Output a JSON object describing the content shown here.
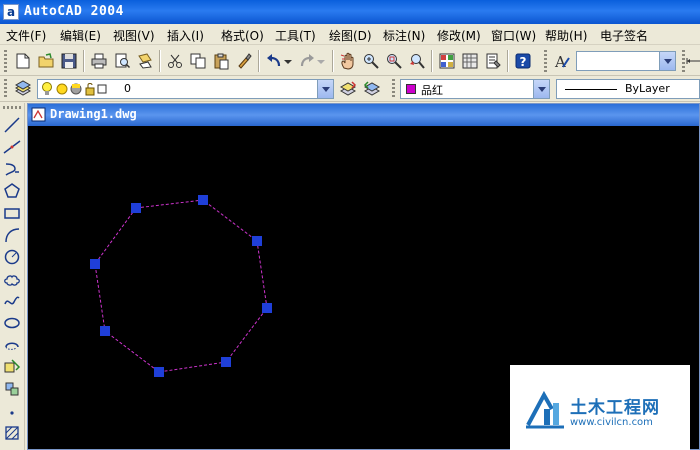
{
  "window": {
    "title": "AutoCAD 2004",
    "app_icon_letter": "a"
  },
  "menu": [
    {
      "label": "文件(F)"
    },
    {
      "label": "编辑(E)"
    },
    {
      "label": "视图(V)"
    },
    {
      "label": "插入(I)"
    },
    {
      "label": "格式(O)"
    },
    {
      "label": "工具(T)"
    },
    {
      "label": "绘图(D)"
    },
    {
      "label": "标注(N)"
    },
    {
      "label": "修改(M)"
    },
    {
      "label": "窗口(W)"
    },
    {
      "label": "帮助(H)"
    },
    {
      "label": "电子签名"
    }
  ],
  "layers": {
    "current_layer": "0",
    "color_value": "品红",
    "color_swatch": "#cc00cc",
    "linetype_value": "ByLayer"
  },
  "drawing": {
    "tab_title": "Drawing1.dwg",
    "background": "#000000",
    "polygon_color": "#cc33cc",
    "grip_color": "#1f3fd8"
  },
  "watermark": {
    "brand": "土木工程网",
    "url": "www.civilcn.com"
  }
}
